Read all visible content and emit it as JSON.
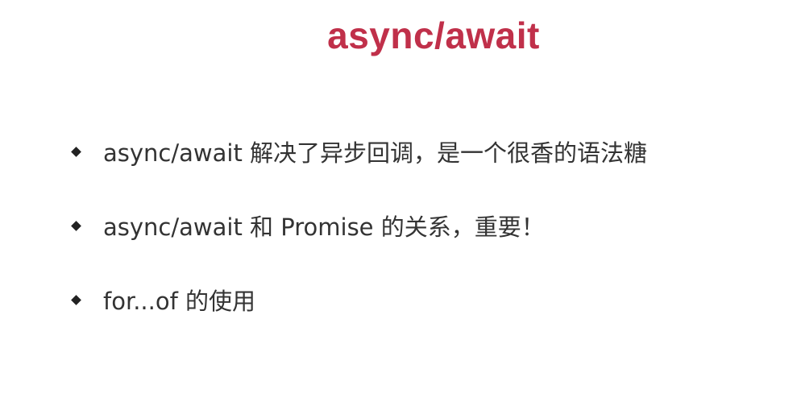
{
  "slide": {
    "title": "async/await",
    "title_color": "#c0304a",
    "bullets": [
      {
        "text": "async/await 解决了异步回调，是一个很香的语法糖"
      },
      {
        "text": "async/await 和 Promise 的关系，重要！"
      },
      {
        "text": "for...of 的使用"
      }
    ],
    "bullet_marker_icon": "diamond-bullet-icon"
  }
}
